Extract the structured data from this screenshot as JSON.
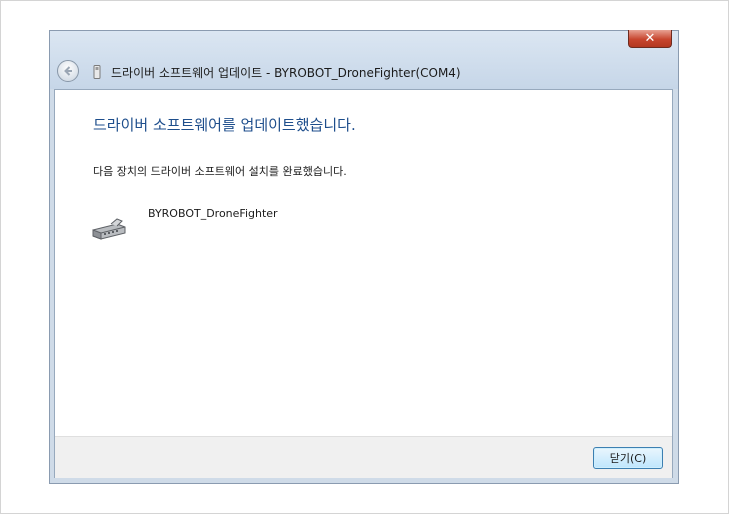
{
  "window": {
    "title": "드라이버 소프트웨어 업데이트 - BYROBOT_DroneFighter(COM4)",
    "close_glyph": "✕"
  },
  "content": {
    "heading": "드라이버 소프트웨어를 업데이트했습니다.",
    "message": "다음 장치의 드라이버 소프트웨어 설치를 완료했습니다.",
    "device_name": "BYROBOT_DroneFighter"
  },
  "footer": {
    "close_label": "닫기(C)"
  },
  "colors": {
    "heading": "#1e4e8c",
    "close_button": "#c7452e",
    "window_frame": "#cfdbe8"
  }
}
